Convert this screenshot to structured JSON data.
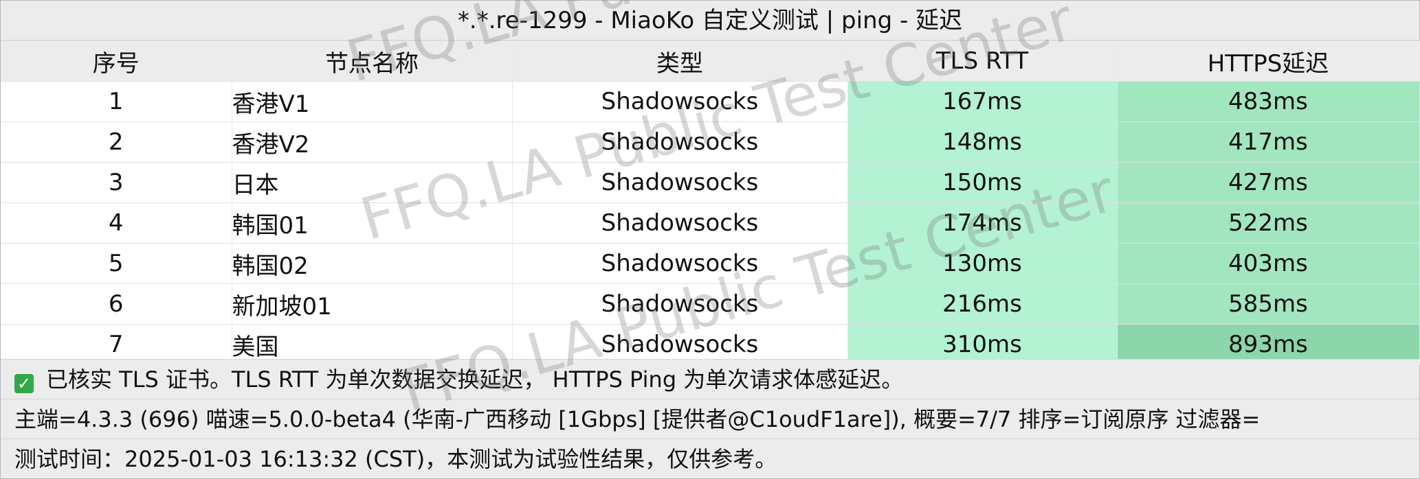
{
  "title": "*.*.re-1299 - MiaoKo 自定义测试 | ping - 延迟",
  "columns": {
    "index": "序号",
    "name": "节点名称",
    "type": "类型",
    "tls": "TLS RTT",
    "https": "HTTPS延迟"
  },
  "rows": [
    {
      "index": "1",
      "name": "香港V1",
      "type": "Shadowsocks",
      "tls": "167ms",
      "https": "483ms"
    },
    {
      "index": "2",
      "name": "香港V2",
      "type": "Shadowsocks",
      "tls": "148ms",
      "https": "417ms"
    },
    {
      "index": "3",
      "name": "日本",
      "type": "Shadowsocks",
      "tls": "150ms",
      "https": "427ms"
    },
    {
      "index": "4",
      "name": "韩国01",
      "type": "Shadowsocks",
      "tls": "174ms",
      "https": "522ms"
    },
    {
      "index": "5",
      "name": "韩国02",
      "type": "Shadowsocks",
      "tls": "130ms",
      "https": "403ms"
    },
    {
      "index": "6",
      "name": "新加坡01",
      "type": "Shadowsocks",
      "tls": "216ms",
      "https": "585ms"
    },
    {
      "index": "7",
      "name": "美国",
      "type": "Shadowsocks",
      "tls": "310ms",
      "https": "893ms"
    }
  ],
  "colors": {
    "tls_cell": "#b3f2d2",
    "https_cell": "#a2e6c0",
    "https_cell_high": "#8cd6ab",
    "check_icon": "#33a84a",
    "header_bg": "#ececec"
  },
  "footer": {
    "note_icon": "check-icon",
    "note": "已核实 TLS 证书。TLS RTT 为单次数据交换延迟， HTTPS Ping 为单次请求体感延迟。",
    "info": "主端=4.3.3 (696) 喵速=5.0.0-beta4 (华南-广西移动 [1Gbps] [提供者@C1oudF1are]), 概要=7/7 排序=订阅原序 过滤器=",
    "time": "测试时间：2025-01-03 16:13:32 (CST)，本测试为试验性结果，仅供参考。"
  },
  "watermark": "FFQ.LA Public Test Center"
}
